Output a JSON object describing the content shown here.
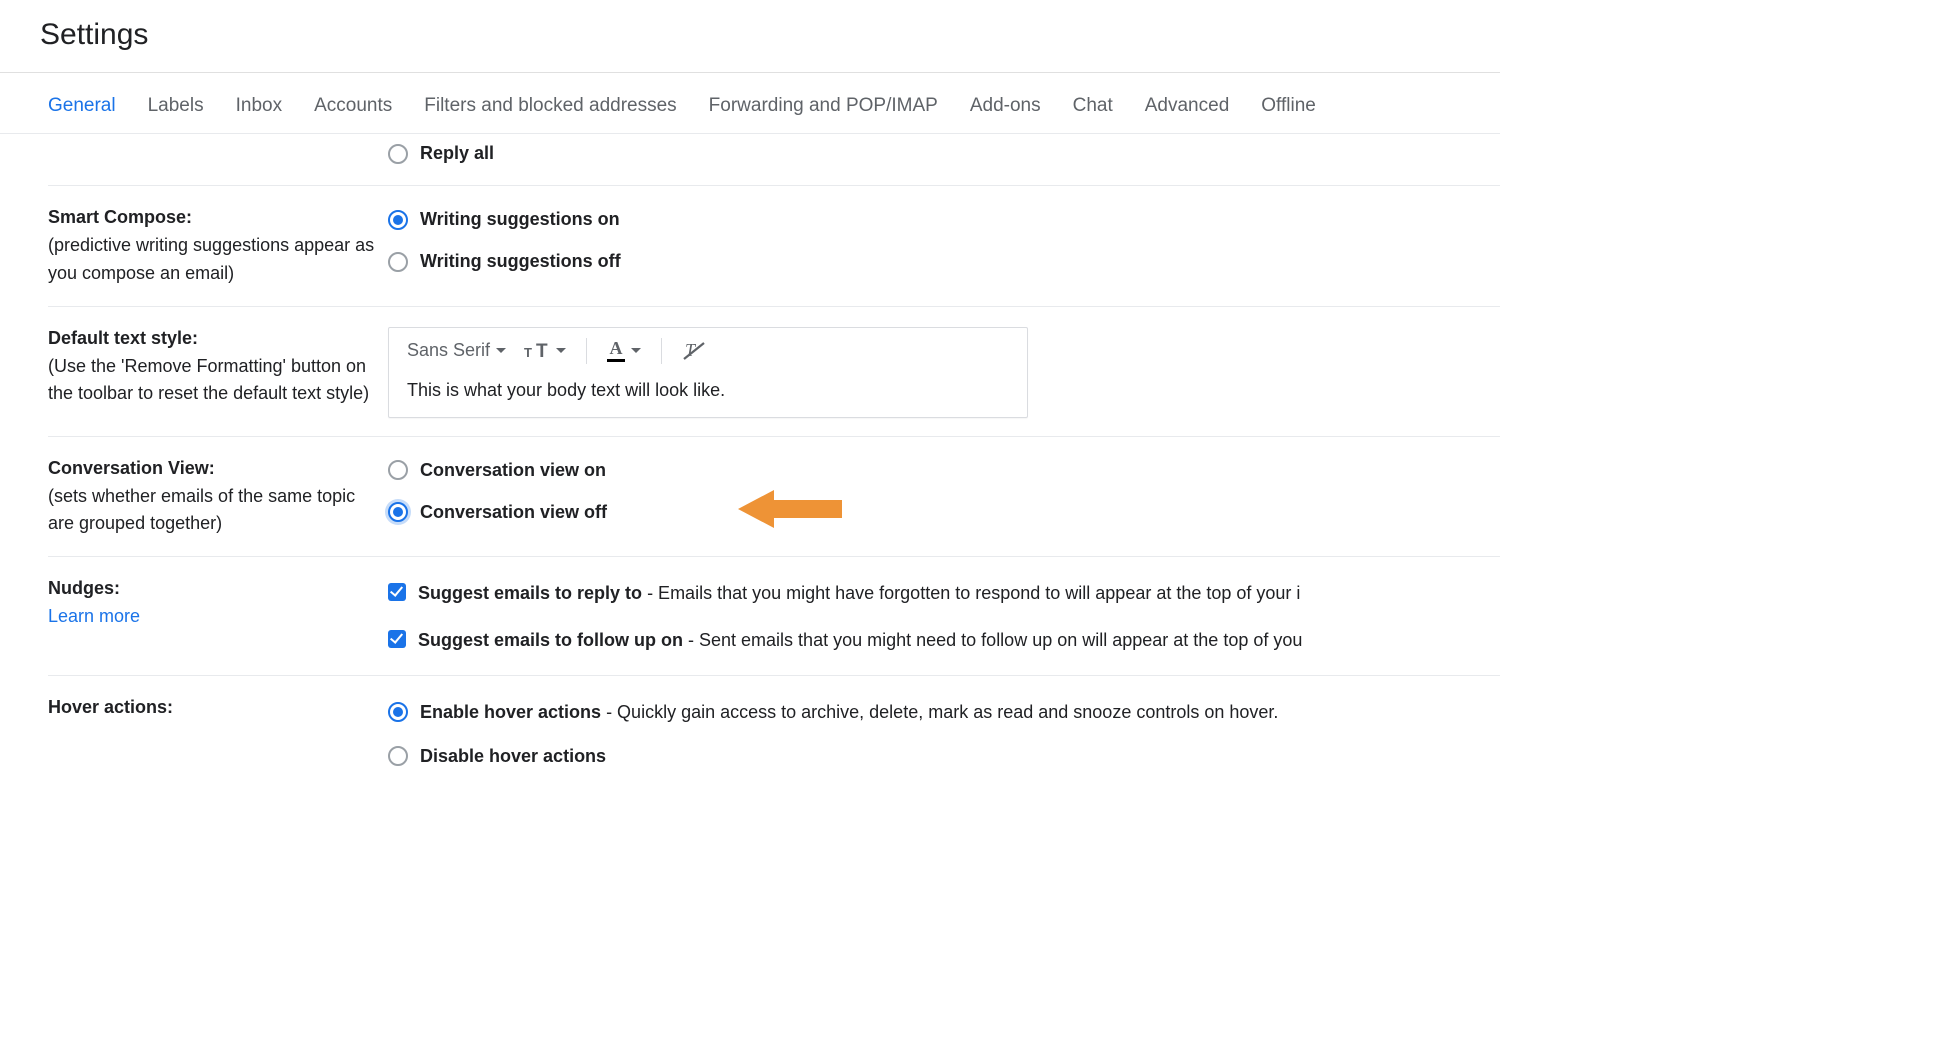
{
  "page": {
    "title": "Settings"
  },
  "tabs": [
    "General",
    "Labels",
    "Inbox",
    "Accounts",
    "Filters and blocked addresses",
    "Forwarding and POP/IMAP",
    "Add-ons",
    "Chat",
    "Advanced",
    "Offline"
  ],
  "active_tab": "General",
  "reply": {
    "opt_reply_all": "Reply all"
  },
  "smart_compose": {
    "title": "Smart Compose:",
    "desc": "(predictive writing suggestions appear as you compose an email)",
    "opt_on": "Writing suggestions on",
    "opt_off": "Writing suggestions off"
  },
  "default_text_style": {
    "title": "Default text style:",
    "desc": "(Use the 'Remove Formatting' button on the toolbar to reset the default text style)",
    "font": "Sans Serif",
    "preview": "This is what your body text will look like."
  },
  "conversation_view": {
    "title": "Conversation View:",
    "desc": "(sets whether emails of the same topic are grouped together)",
    "opt_on": "Conversation view on",
    "opt_off": "Conversation view off"
  },
  "nudges": {
    "title": "Nudges:",
    "learn_more": "Learn more",
    "reply_label": "Suggest emails to reply to",
    "reply_desc": " - Emails that you might have forgotten to respond to will appear at the top of your i",
    "followup_label": "Suggest emails to follow up on",
    "followup_desc": " - Sent emails that you might need to follow up on will appear at the top of you"
  },
  "hover_actions": {
    "title": "Hover actions:",
    "enable_label": "Enable hover actions",
    "enable_desc": " - Quickly gain access to archive, delete, mark as read and snooze controls on hover.",
    "disable_label": "Disable hover actions"
  },
  "annotation": {
    "arrow_color": "#ee9336"
  }
}
